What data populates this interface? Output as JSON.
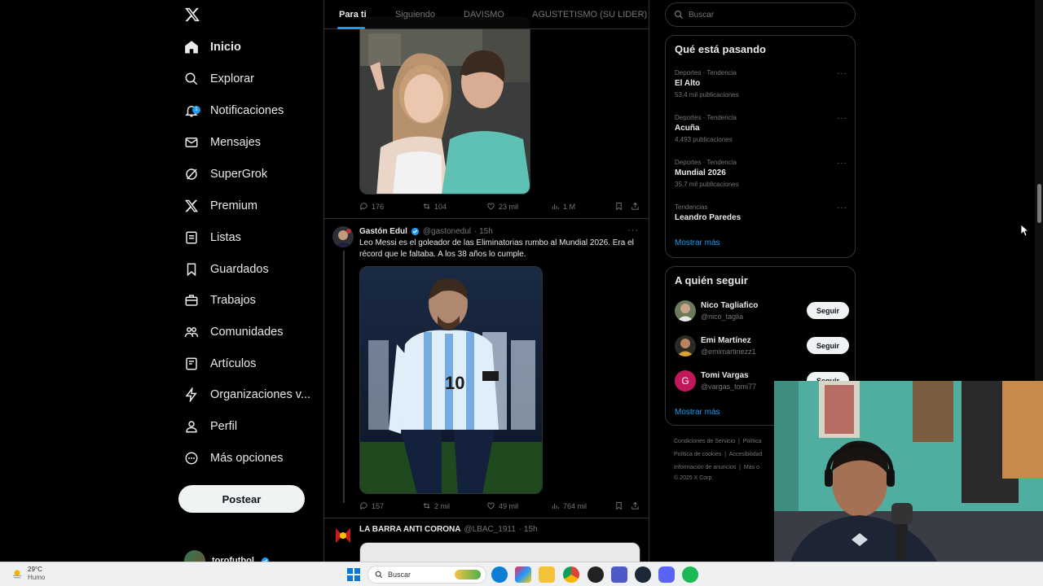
{
  "nav": {
    "items": [
      {
        "label": "Inicio",
        "icon": "home-icon",
        "active": true
      },
      {
        "label": "Explorar",
        "icon": "search-icon"
      },
      {
        "label": "Notificaciones",
        "icon": "bell-icon",
        "badge": "1"
      },
      {
        "label": "Mensajes",
        "icon": "mail-icon"
      },
      {
        "label": "SuperGrok",
        "icon": "grok-icon"
      },
      {
        "label": "Premium",
        "icon": "x-logo-icon"
      },
      {
        "label": "Listas",
        "icon": "list-icon"
      },
      {
        "label": "Guardados",
        "icon": "bookmark-icon"
      },
      {
        "label": "Trabajos",
        "icon": "briefcase-icon"
      },
      {
        "label": "Comunidades",
        "icon": "people-icon"
      },
      {
        "label": "Artículos",
        "icon": "article-icon"
      },
      {
        "label": "Organizaciones v...",
        "icon": "lightning-icon"
      },
      {
        "label": "Perfil",
        "icon": "person-icon"
      },
      {
        "label": "Más opciones",
        "icon": "more-circle-icon"
      }
    ],
    "post_label": "Postear",
    "account_name": "torofutbol"
  },
  "tabs": [
    "Para ti",
    "Siguiendo",
    "DAVISMO",
    "AGUSTETISMO (SU LIDER)"
  ],
  "posts": [
    {
      "stats": {
        "replies": "176",
        "reposts": "104",
        "likes": "23 mil",
        "views": "1 M"
      }
    },
    {
      "name": "Gastón Edul",
      "handle": "@gastonedul",
      "time": "· 15h",
      "text": "Leo Messi es el goleador de las Eliminatorias rumbo al Mundial 2026. Era el récord que le faltaba. A los 38 años lo cumple.",
      "stats": {
        "replies": "157",
        "reposts": "2 mil",
        "likes": "49 mil",
        "views": "764 mil"
      }
    },
    {
      "name": "LA BARRA ANTI CORONA",
      "handle": "@LBAC_1911",
      "time": "· 15h"
    }
  ],
  "search": {
    "placeholder": "Buscar"
  },
  "trending": {
    "title": "Qué está pasando",
    "items": [
      {
        "context": "Deportes · Tendencia",
        "title": "El Alto",
        "count": "53,4 mil publicaciones"
      },
      {
        "context": "Deportes · Tendencia",
        "title": "Acuña",
        "count": "4.493 publicaciones"
      },
      {
        "context": "Deportes · Tendencia",
        "title": "Mundial 2026",
        "count": "35,7 mil publicaciones"
      },
      {
        "context": "Tendencias",
        "title": "Leandro Paredes",
        "count": ""
      }
    ],
    "show_more": "Mostrar más"
  },
  "who_to_follow": {
    "title": "A quién seguir",
    "items": [
      {
        "name": "Nico Tagliafico",
        "handle": "@nico_taglia",
        "button": "Seguir"
      },
      {
        "name": "Emi Martínez",
        "handle": "@emimartinezz1",
        "button": "Seguir"
      },
      {
        "name": "Tomi Vargas",
        "handle": "@vargas_tomi77",
        "button": "Seguir",
        "initial": "G"
      }
    ],
    "show_more": "Mostrar más"
  },
  "footer": {
    "line1": [
      "Condiciones de Servicio",
      "|",
      "Política"
    ],
    "line2": [
      "Política de cookies",
      "|",
      "Accesibilidad"
    ],
    "line3": [
      "Información de anuncios",
      "|",
      "Más o"
    ],
    "copyright": "© 2025 X Corp."
  },
  "taskbar": {
    "temp": "29°C",
    "condition": "Humo",
    "search_label": "Buscar"
  },
  "colors": {
    "accent": "#1d9bf0",
    "background": "#000000",
    "border": "#2f3336",
    "muted": "#71767b"
  }
}
